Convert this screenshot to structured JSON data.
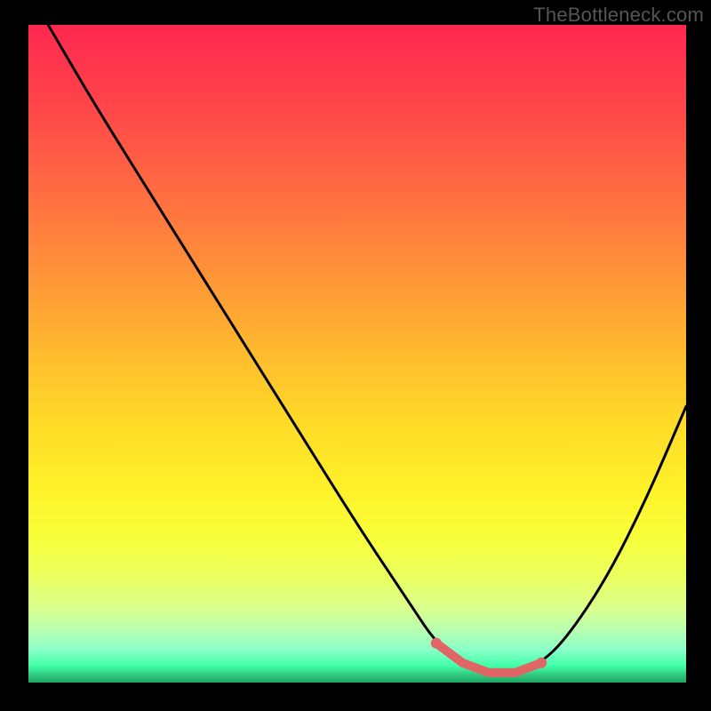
{
  "watermark": "TheBottleneck.com",
  "colors": {
    "curve": "#000000",
    "highlight": "#e06666",
    "gradient_top": "#ff2850",
    "gradient_mid": "#ffd928",
    "gradient_bottom": "#1aa860"
  },
  "chart_data": {
    "type": "line",
    "title": "",
    "xlabel": "",
    "ylabel": "",
    "xlim": [
      0,
      100
    ],
    "ylim": [
      0,
      100
    ],
    "grid": false,
    "legend": false,
    "series": [
      {
        "name": "bottleneck_curve",
        "x": [
          3,
          10,
          20,
          30,
          40,
          50,
          58,
          62,
          66,
          70,
          74,
          78,
          82,
          88,
          94,
          100
        ],
        "y": [
          100,
          88,
          72,
          56,
          40,
          24,
          12,
          6,
          3,
          1.5,
          1.5,
          3,
          7,
          16,
          28,
          42
        ]
      }
    ],
    "highlight_range": {
      "x_start": 62,
      "x_end": 78
    },
    "annotations": []
  }
}
